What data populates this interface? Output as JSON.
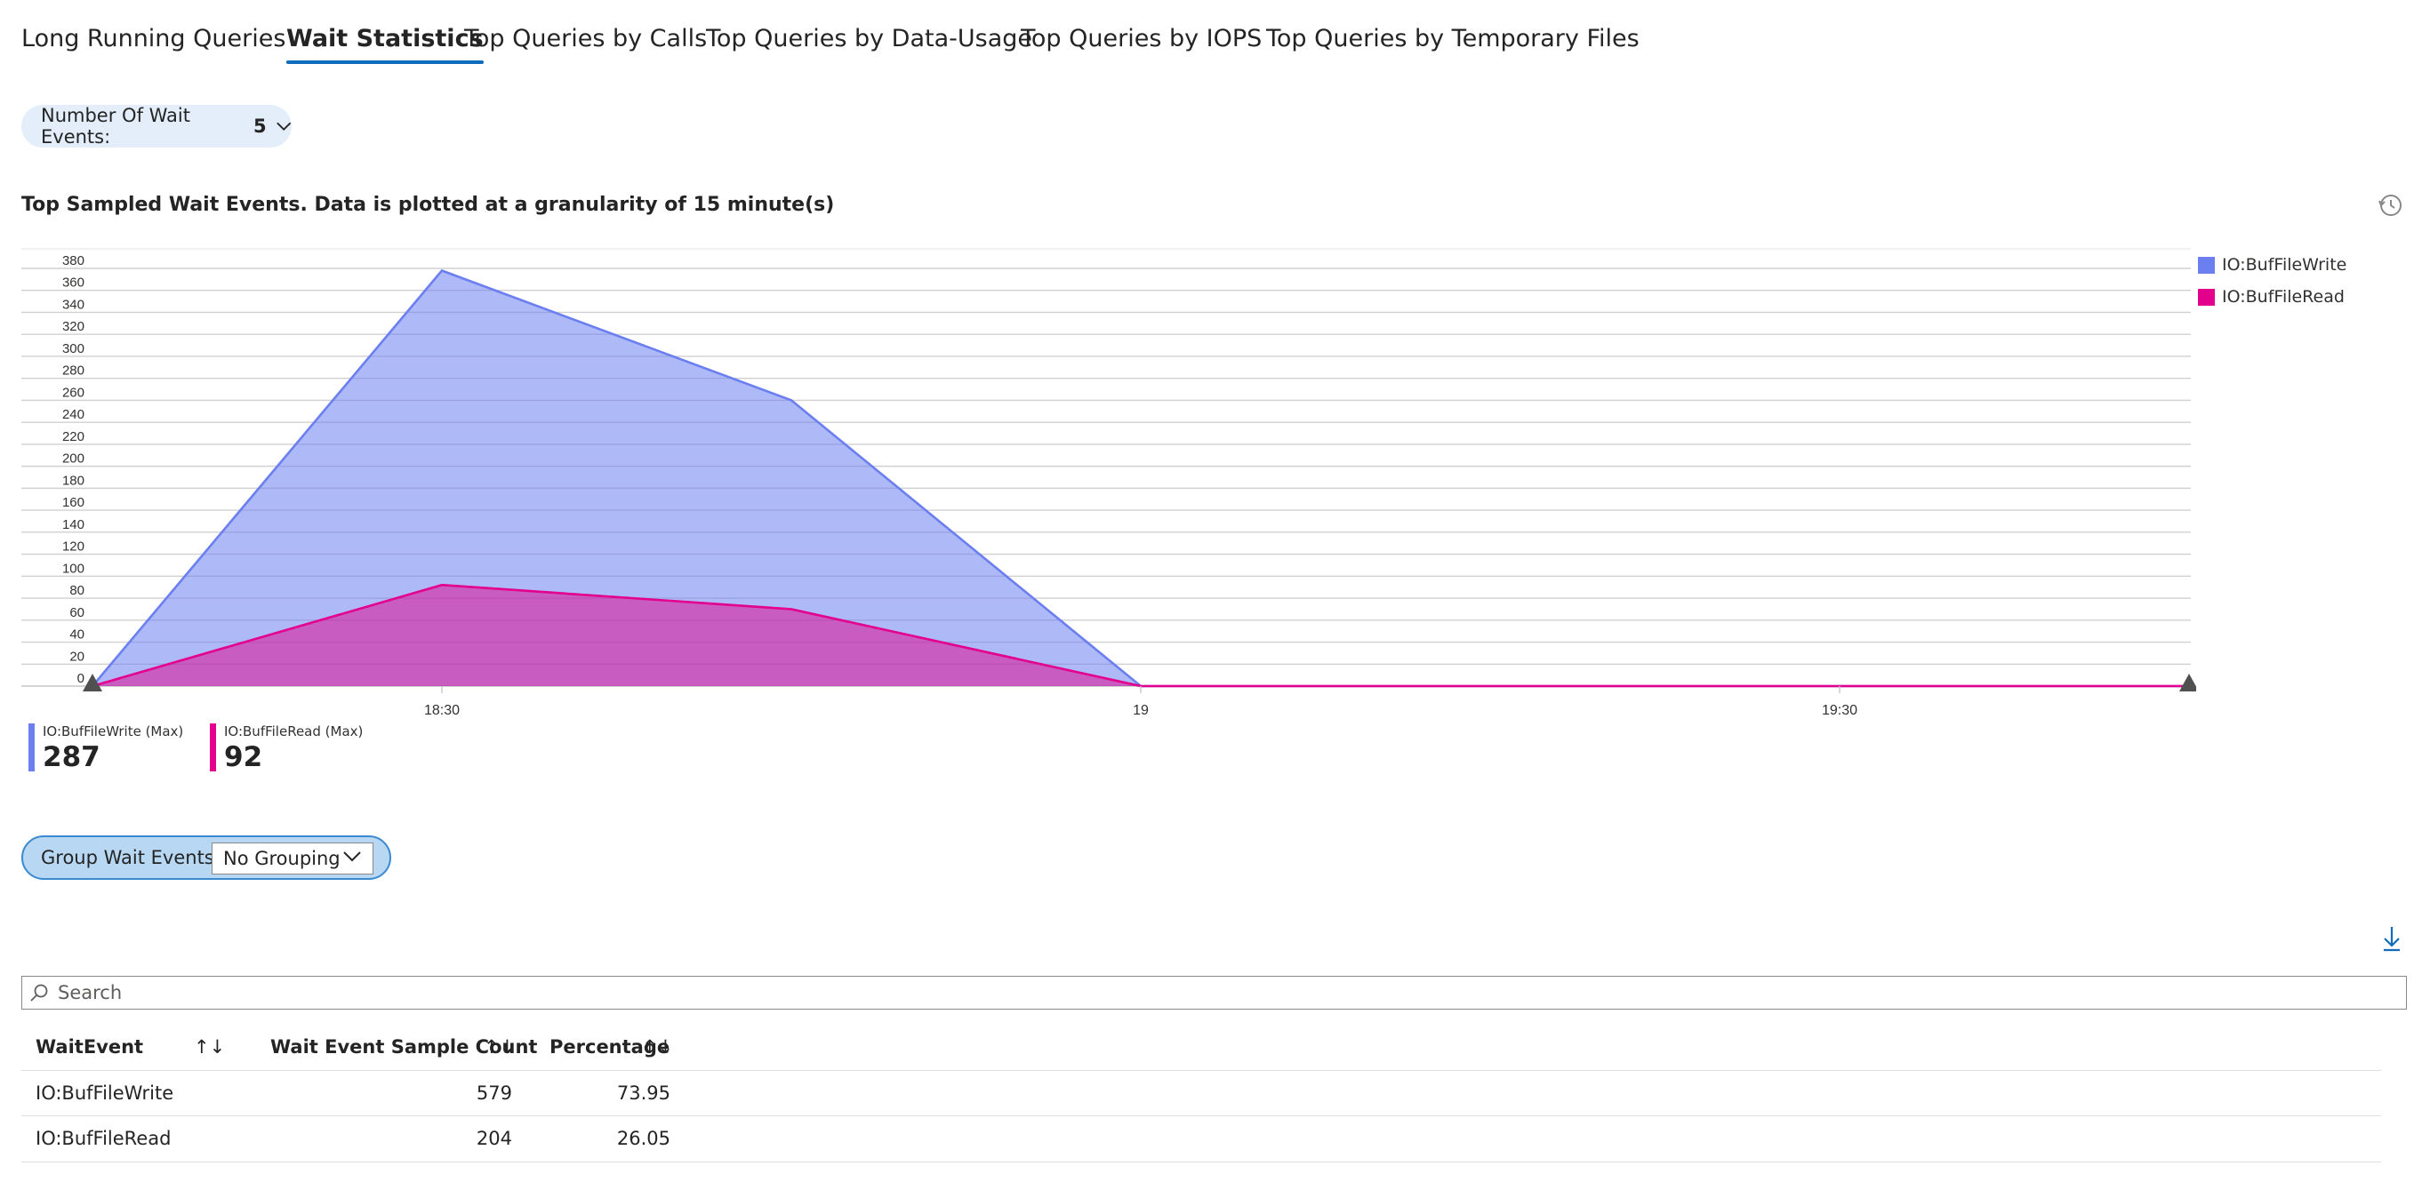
{
  "tabs": [
    {
      "label": "Long Running Queries"
    },
    {
      "label": "Wait Statistics"
    },
    {
      "label": "Top Queries by Calls"
    },
    {
      "label": "Top Queries by Data-Usage"
    },
    {
      "label": "Top Queries by IOPS"
    },
    {
      "label": "Top Queries by Temporary Files"
    }
  ],
  "active_tab": "Wait Statistics",
  "filter": {
    "label": "Number Of Wait Events:",
    "value": "5"
  },
  "section_title": "Top Sampled Wait Events. Data is plotted at a granularity of 15 minute(s)",
  "chart_data": {
    "type": "area",
    "x": [
      "18:15",
      "18:30",
      "18:45",
      "19:00",
      "19:15",
      "19:30",
      "19:45"
    ],
    "x_tick_labels": [
      "18:30",
      "19",
      "19:30"
    ],
    "ylim": [
      0,
      380
    ],
    "y_ticks": [
      0,
      20,
      40,
      60,
      80,
      100,
      120,
      140,
      160,
      180,
      200,
      220,
      240,
      260,
      280,
      300,
      320,
      340,
      360,
      380
    ],
    "grid": true,
    "legend_position": "right",
    "series": [
      {
        "name": "IO:BufFileWrite",
        "color": "#6b7ff0",
        "values": [
          0,
          378,
          260,
          0,
          0,
          0,
          0
        ]
      },
      {
        "name": "IO:BufFileRead",
        "color": "#e3008c",
        "values": [
          0,
          92,
          70,
          0,
          0,
          0,
          0
        ]
      }
    ]
  },
  "metrics": [
    {
      "label": "IO:BufFileWrite (Max)",
      "value": "287",
      "color": "#6b7ff0"
    },
    {
      "label": "IO:BufFileRead (Max)",
      "value": "92",
      "color": "#e3008c"
    }
  ],
  "grouping": {
    "label": "Group Wait Events:",
    "value": "No Grouping"
  },
  "search": {
    "placeholder": "Search",
    "value": ""
  },
  "table": {
    "columns": [
      "WaitEvent",
      "Wait Event Sample Count",
      "Percentage"
    ],
    "sort_glyph": "↑↓",
    "rows": [
      {
        "event": "IO:BufFileWrite",
        "count": "579",
        "percentage": "73.95"
      },
      {
        "event": "IO:BufFileRead",
        "count": "204",
        "percentage": "26.05"
      }
    ]
  }
}
